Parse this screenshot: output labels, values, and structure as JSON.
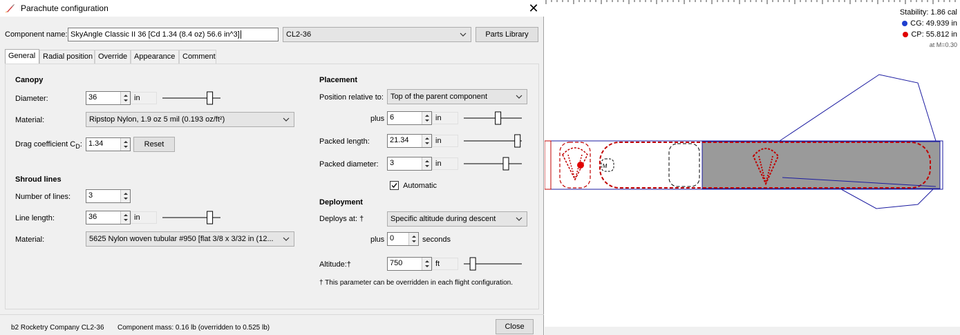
{
  "window": {
    "title": "Parachute configuration",
    "close_glyph": "✕"
  },
  "header": {
    "component_name_label": "Component name:",
    "component_name_value": "SkyAngle Classic II 36 [Cd 1.34 (8.4 oz) 56.6 in^3]",
    "preset_value": "CL2-36",
    "parts_library_label": "Parts Library"
  },
  "tabs": [
    {
      "label": "General",
      "active": true
    },
    {
      "label": "Radial position",
      "active": false
    },
    {
      "label": "Override",
      "active": false
    },
    {
      "label": "Appearance",
      "active": false
    },
    {
      "label": "Comment",
      "active": false
    }
  ],
  "canopy": {
    "heading": "Canopy",
    "diameter_label": "Diameter:",
    "diameter_value": "36",
    "diameter_unit": "in",
    "diameter_slider_fraction": 0.85,
    "material_label": "Material:",
    "material_value": "Ripstop Nylon, 1.9 oz 5 mil (0.193 oz/ft²)",
    "drag_label": "Drag coefficient C",
    "drag_sub": "D",
    "drag_colon": ":",
    "drag_value": "1.34",
    "reset_label": "Reset"
  },
  "shroud": {
    "heading": "Shroud lines",
    "lines_label": "Number of lines:",
    "lines_value": "3",
    "length_label": "Line length:",
    "length_value": "36",
    "length_unit": "in",
    "length_slider_fraction": 0.85,
    "material_label": "Material:",
    "material_value": "5625 Nylon woven tubular #950 [flat 3/8 x 3/32 in (12..."
  },
  "placement": {
    "heading": "Placement",
    "position_label": "Position relative to:",
    "position_value": "Top of the parent component",
    "plus_label": "plus",
    "plus_value": "6",
    "plus_unit": "in",
    "plus_slider_fraction": 0.6,
    "packed_length_label": "Packed length:",
    "packed_length_value": "21.34",
    "packed_length_unit": "in",
    "packed_length_slider_fraction": 0.97,
    "packed_diameter_label": "Packed diameter:",
    "packed_diameter_value": "3",
    "packed_diameter_unit": "in",
    "packed_diameter_slider_fraction": 0.75,
    "automatic_label": "Automatic",
    "automatic_checked": true
  },
  "deployment": {
    "heading": "Deployment",
    "deploys_label": "Deploys at: †",
    "deploys_value": "Specific altitude during descent",
    "plus_label": "plus",
    "plus_value": "0",
    "plus_unit": "seconds",
    "altitude_label": "Altitude:†",
    "altitude_value": "750",
    "altitude_unit": "ft",
    "altitude_slider_fraction": 0.12,
    "footnote": "† This parameter can be overridden in each flight configuration."
  },
  "footer": {
    "manufacturer": "b2 Rocketry Company CL2-36",
    "mass": "Component mass: 0.16 lb (overridden to 0.525 lb)",
    "close_label": "Close"
  },
  "figure": {
    "stability": "Stability:  1.86 cal",
    "cg": "CG: 49.939 in",
    "cp": "CP: 55.812 in",
    "mach": "at M=0.30",
    "cg_color": "#1f3fcf",
    "cp_color": "#e00000",
    "body_color": "#1a1aa0",
    "recovery_color": "#c00000",
    "fill_color": "#9a9a9a"
  }
}
